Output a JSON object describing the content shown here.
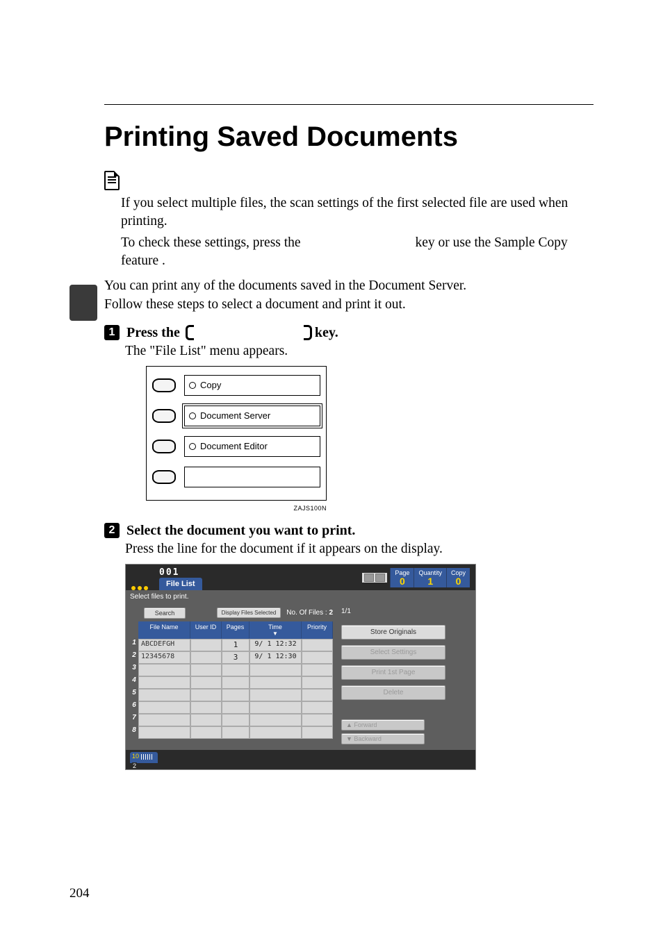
{
  "page_number": "204",
  "title": "Printing Saved Documents",
  "important": {
    "line1": "If you select multiple files, the scan settings of the first selected file are used when printing.",
    "line2_pre": "To check these settings, press the ",
    "line2_post": " key or use the Sample Copy feature ."
  },
  "intro1": "You can print any of the documents saved in the Document Server.",
  "intro2": "Follow these steps to select a document and print it out.",
  "steps": {
    "s1_pre": "Press the ",
    "s1_post": " key.",
    "s1_sub": "The \"File List\" menu appears.",
    "s2": "Select the document you want to print.",
    "s2_sub": "Press the line for the document if it appears on the display."
  },
  "mode_panel": {
    "rows": [
      "Copy",
      "Document Server",
      "Document Editor",
      ""
    ],
    "selected_index": 1,
    "caption": "ZAJS100N"
  },
  "screen": {
    "pin": "001",
    "tab": "File List",
    "stats": {
      "page_l": "Page",
      "page_v": "0",
      "qty_l": "Quantity",
      "qty_v": "1",
      "copy_l": "Copy",
      "copy_v": "0"
    },
    "hint": "Select files to print.",
    "search_btn": "Search",
    "display_sel_btn": "Display Files Selected",
    "nof_label": "No. Of Files",
    "nof_value": "2",
    "page_frac": "1/1",
    "headers": {
      "fn": "File Name",
      "uid": "User ID",
      "pg": "Pages",
      "tm": "Time",
      "pr": "Priority"
    },
    "rows": [
      {
        "n": "1",
        "fn": "ABCDEFGH",
        "pg": "1",
        "tm": "9/  1  12:32"
      },
      {
        "n": "2",
        "fn": "12345678",
        "pg": "3",
        "tm": "9/  1  12:30"
      },
      {
        "n": "3"
      },
      {
        "n": "4"
      },
      {
        "n": "5"
      },
      {
        "n": "6"
      },
      {
        "n": "7"
      },
      {
        "n": "8"
      }
    ],
    "right_buttons": {
      "store": "Store Originals",
      "select": "Select Settings",
      "first": "Print 1st Page",
      "delete": "Delete",
      "fwd": "Forward",
      "bwd": "Backward"
    }
  }
}
